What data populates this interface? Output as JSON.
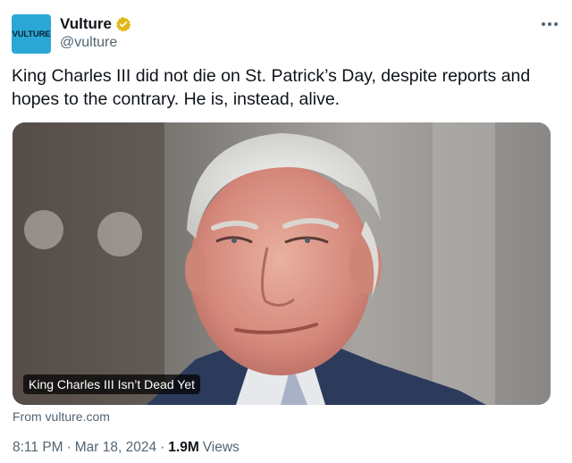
{
  "account": {
    "avatar_text": "VULTURE",
    "display_name": "Vulture",
    "handle": "@vulture",
    "verified_color": "#e2b719",
    "avatar_color": "#2aa7d4"
  },
  "tweet": {
    "text": "King Charles III did not die on St. Patrick’s Day, despite reports and hopes to the contrary. He is, instead, alive."
  },
  "card": {
    "caption": "King Charles III Isn’t Dead Yet",
    "source": "From vulture.com"
  },
  "meta": {
    "time": "8:11 PM",
    "separator": "·",
    "date": "Mar 18, 2024",
    "views_count": "1.9M",
    "views_label": "Views"
  },
  "icons": {
    "verified": "verified-badge-icon",
    "more": "more-options-icon"
  }
}
